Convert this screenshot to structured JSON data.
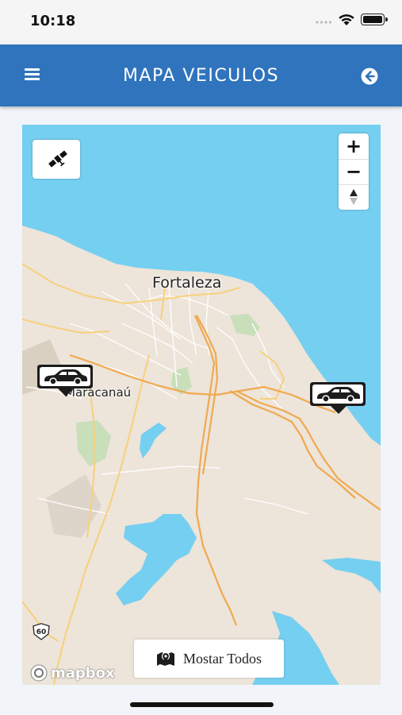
{
  "status_bar": {
    "time": "10:18"
  },
  "header": {
    "title": "MAPA VEICULOS",
    "menu_icon": "hamburger-icon",
    "back_icon": "arrow-left-circle-icon"
  },
  "map": {
    "colors": {
      "water": "#75cff0",
      "land": "#ede4da",
      "park": "#c8dfb9",
      "road_major": "#f0a94f",
      "road_secondary": "#f7d07a"
    },
    "labels": {
      "city_main": "Fortaleza",
      "city_secondary": "Maracanaú",
      "road_shield": "60"
    },
    "controls": {
      "satellite_icon": "satellite-icon",
      "zoom_in": "+",
      "zoom_out": "−",
      "compass_icon": "compass-icon"
    },
    "attribution": "mapbox",
    "vehicles": [
      {
        "icon": "car-icon"
      },
      {
        "icon": "car-icon"
      }
    ]
  },
  "actions": {
    "show_all_label": "Mostar Todos",
    "show_all_icon": "map-marker-icon"
  }
}
